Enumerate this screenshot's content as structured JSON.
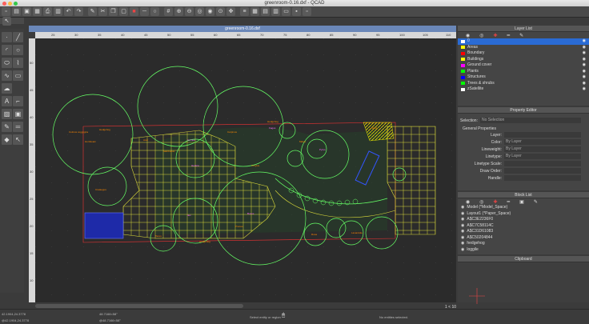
{
  "window": {
    "title": "greenroom-0.16.dxf - QCAD"
  },
  "document": {
    "tab_title": "greenroom-0.16.dxf"
  },
  "ruler": {
    "top_ticks": [
      "25",
      "30",
      "35",
      "40",
      "45",
      "50",
      "55",
      "60",
      "65",
      "70",
      "75",
      "80",
      "85",
      "90",
      "95",
      "100",
      "105",
      "110"
    ],
    "left_ticks": [
      "10",
      "15",
      "20",
      "25",
      "30",
      "35",
      "40",
      "45",
      "50"
    ]
  },
  "layer_list": {
    "title": "Layer List",
    "layers": [
      {
        "name": "0",
        "color": "#ffffff"
      },
      {
        "name": "Areas",
        "color": "#ffff00"
      },
      {
        "name": "Boundary",
        "color": "#ff0000"
      },
      {
        "name": "Buildings",
        "color": "#ffff00"
      },
      {
        "name": "Ground cover",
        "color": "#ff00ff"
      },
      {
        "name": "Plants",
        "color": "#00ff00"
      },
      {
        "name": "Structures",
        "color": "#0000ff"
      },
      {
        "name": "Trees & shrubs",
        "color": "#00ff00"
      },
      {
        "name": "zSatellite",
        "color": "#ffffff"
      }
    ]
  },
  "property_editor": {
    "title": "Property Editor",
    "selection_label": "Selection:",
    "selection_value": "No Selection",
    "general_heading": "General Properties",
    "props": [
      {
        "label": "Layer:",
        "value": ""
      },
      {
        "label": "Color:",
        "value": "By Layer"
      },
      {
        "label": "Lineweight:",
        "value": "By Layer"
      },
      {
        "label": "Linetype:",
        "value": "By Layer"
      },
      {
        "label": "Linetype Scale:",
        "value": ""
      },
      {
        "label": "Draw Order:",
        "value": ""
      },
      {
        "label": "Handle:",
        "value": ""
      }
    ]
  },
  "block_list": {
    "title": "Block List",
    "blocks": [
      "Model (*Model_Space)",
      "Layout1 (*Paper_Space)",
      "A$C3E2236F0",
      "A$C7C58114C",
      "A$C31D61083",
      "A$C50204844",
      "hedgehog",
      "loggile"
    ]
  },
  "clipboard": {
    "title": "Clipboard"
  },
  "status": {
    "coord1": "42.1904,24.3778",
    "coord2": "@42.1904,24.3778",
    "coord3": "48.7166<58°",
    "coord4": "@48.7166<58°",
    "selection_hint": "Select entity or region",
    "no_entities": "No entities selected.",
    "ratio": "1 < 10"
  },
  "colors": {
    "accent": "#6a87b8",
    "canvas": "#2b2b2b",
    "selected_row": "#2a6bd4"
  }
}
